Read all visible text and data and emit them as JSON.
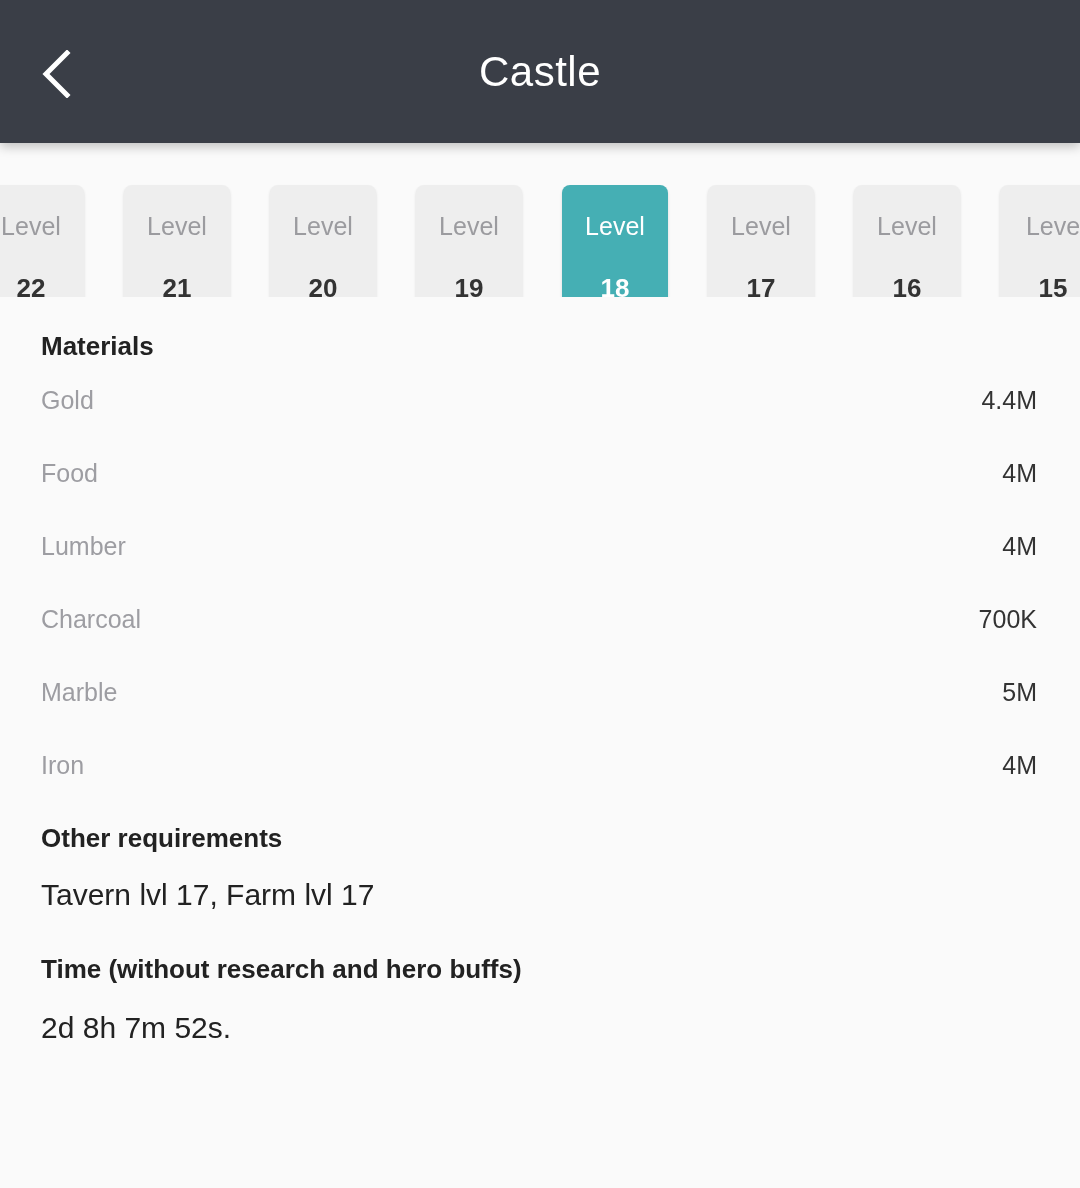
{
  "header": {
    "title": "Castle"
  },
  "levels": [
    {
      "label": "Level",
      "number": "22",
      "selected": false
    },
    {
      "label": "Level",
      "number": "21",
      "selected": false
    },
    {
      "label": "Level",
      "number": "20",
      "selected": false
    },
    {
      "label": "Level",
      "number": "19",
      "selected": false
    },
    {
      "label": "Level",
      "number": "18",
      "selected": true
    },
    {
      "label": "Level",
      "number": "17",
      "selected": false
    },
    {
      "label": "Level",
      "number": "16",
      "selected": false
    },
    {
      "label": "Leve",
      "number": "15",
      "selected": false
    }
  ],
  "materials": {
    "heading": "Materials",
    "items": [
      {
        "name": "Gold",
        "amount": "4.4M"
      },
      {
        "name": "Food",
        "amount": "4M"
      },
      {
        "name": "Lumber",
        "amount": "4M"
      },
      {
        "name": "Charcoal",
        "amount": "700K"
      },
      {
        "name": "Marble",
        "amount": "5M"
      },
      {
        "name": "Iron",
        "amount": "4M"
      }
    ]
  },
  "other_requirements": {
    "heading": "Other requirements",
    "text": "Tavern lvl 17, Farm lvl 17"
  },
  "time": {
    "heading": "Time (without research and hero buffs)",
    "text": "2d 8h 7m 52s."
  }
}
